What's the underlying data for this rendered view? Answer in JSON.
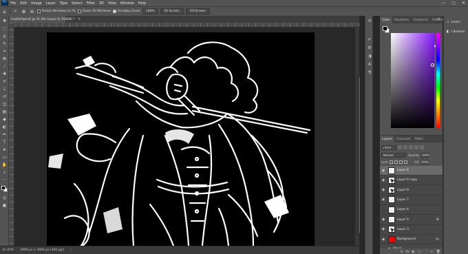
{
  "app": {
    "logo": "Ps"
  },
  "menu": [
    "File",
    "Edit",
    "Image",
    "Layer",
    "Type",
    "Select",
    "Filter",
    "3D",
    "View",
    "Window",
    "Help"
  ],
  "window_controls": {
    "minimize": "—",
    "maximize": "▢",
    "close": "✕"
  },
  "options_bar": {
    "resize_windows_label": "Resize Windows to Fit",
    "zoom_all_windows_label": "Zoom All Windows",
    "scrubby_zoom_label": "Scrubby Zoom",
    "zoom_value": "100%",
    "fit_screen_label": "Fit Screen",
    "fill_screen_label": "Fill Screen"
  },
  "document": {
    "tab_title": "CastleOpen2 @ 31.4% (Layer 8, RGB/8) *",
    "close_glyph": "×"
  },
  "status_bar": {
    "zoom": "31.95%",
    "doc_info": "3900 px x 3900 px (300 ppi)",
    "arrow": "›"
  },
  "color_panel": {
    "tabs": [
      "Color",
      "Swatches",
      "Gradients",
      "Patterns"
    ],
    "active_tab": 0,
    "foreground": "#000000",
    "background": "#ffffff",
    "hue_color": "#8a1cff",
    "menu_glyph": "≡"
  },
  "layers_panel": {
    "tabs": [
      "Layers",
      "Channels",
      "Paths"
    ],
    "active_tab": 0,
    "kind_label": "Kind",
    "blend_mode": "Normal",
    "opacity_label": "Opacity:",
    "opacity_value": "100%",
    "lock_label": "Lock:",
    "fill_label": "Fill:",
    "fill_value": "100%",
    "layers": [
      {
        "name": "Layer 8",
        "visible": true,
        "selected": true,
        "thumb": "light",
        "extra": ""
      },
      {
        "name": "Layer 9 copy",
        "visible": true,
        "selected": false,
        "thumb": "dark",
        "extra": ""
      },
      {
        "name": "Layer 9",
        "visible": true,
        "selected": false,
        "thumb": "dark",
        "extra": ""
      },
      {
        "name": "Layer 7",
        "visible": true,
        "selected": false,
        "thumb": "light",
        "extra": ""
      },
      {
        "name": "Layer 4",
        "visible": false,
        "selected": false,
        "thumb": "light",
        "extra": ""
      },
      {
        "name": "Layer 5",
        "visible": true,
        "selected": false,
        "thumb": "light",
        "extra": "⊕"
      },
      {
        "name": "Layer 3",
        "visible": true,
        "selected": false,
        "thumb": "dark",
        "extra": ""
      },
      {
        "name": "Background",
        "visible": true,
        "selected": false,
        "thumb": "red",
        "extra": "fx"
      }
    ],
    "effects_label": "Effects",
    "footer_icons": [
      "⊝",
      "fx",
      "◐",
      "▢",
      "🗀",
      "＋",
      "🗑"
    ]
  },
  "right_strip": {
    "items": [
      {
        "icon": "⌕",
        "label": "Learn"
      },
      {
        "icon": "◧",
        "label": "Libraries"
      }
    ]
  }
}
